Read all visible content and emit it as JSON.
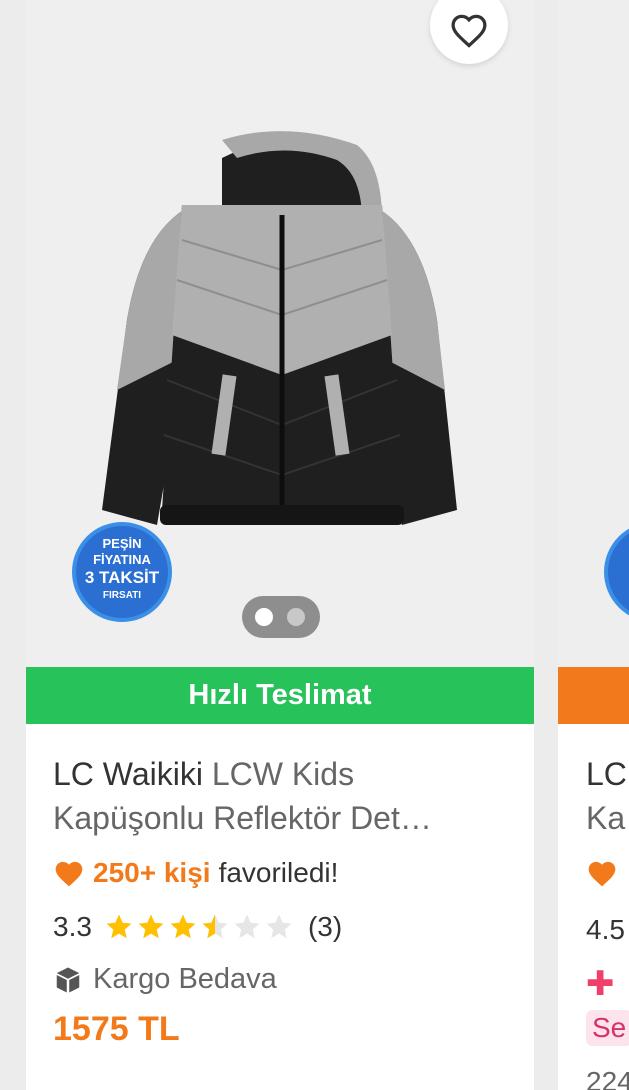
{
  "product": {
    "delivery_label": "Hızlı Teslimat",
    "brand": "LC Waikiki",
    "name_part1": "LCW Kids",
    "name_part2": "Kapüşonlu Reflektör Det…",
    "favorites_count": "250+ kişi",
    "favorites_suffix": "favoriledi!",
    "rating": "3.3",
    "rating_value": 3.5,
    "review_count": "(3)",
    "shipping_label": "Kargo Bedava",
    "price": "1575 TL",
    "badge_lines": [
      "PEŞİN",
      "FİYATINA",
      "3 TAKSİT",
      "FIRSATI"
    ],
    "image_count": 2,
    "active_image": 1
  },
  "next_product": {
    "delivery_color": "#f27a1a",
    "title_start": "LC",
    "title_start2": "Ka",
    "rating_start": "4.5",
    "tag_start": "Se",
    "count_start": "224"
  },
  "colors": {
    "accent": "#f27a1a",
    "delivery_green": "#27c25a",
    "star": "#ffc000"
  }
}
